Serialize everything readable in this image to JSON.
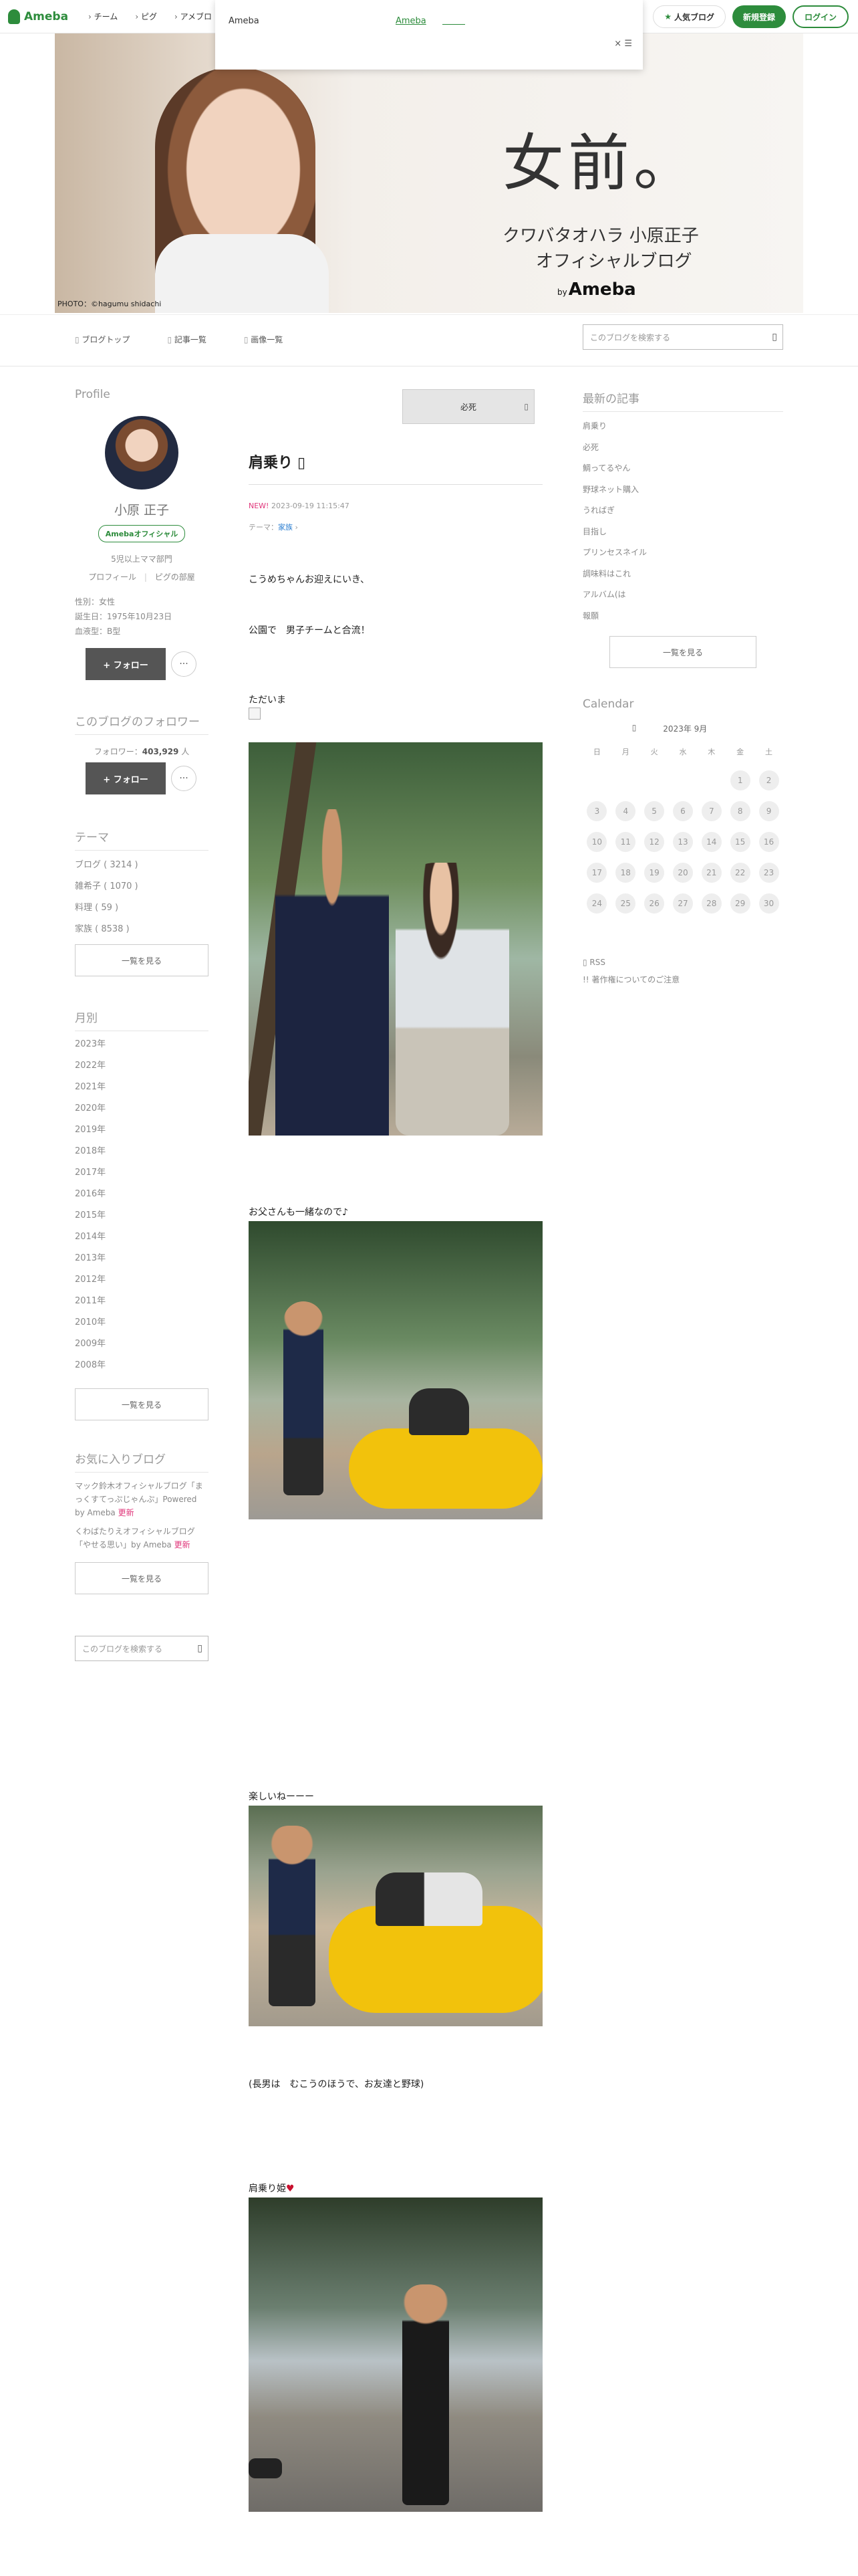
{
  "topbar": {
    "logo": "Ameba",
    "nav": [
      "チーム",
      "ピグ",
      "アメブロ"
    ],
    "popular": "人気ブログ",
    "register": "新規登録",
    "login": "ログイン"
  },
  "notice": {
    "left": "Ameba",
    "right": "Ameba",
    "close": "×"
  },
  "banner": {
    "title": "女前。",
    "sub1": "クワバタオハラ 小原正子",
    "sub2": "オフィシャルブログ",
    "by": "by",
    "brand": "Ameba",
    "credit": "PHOTO：©hagumu shidachi"
  },
  "subnav": {
    "links": [
      "ブログトップ",
      "記事一覧",
      "画像一覧"
    ],
    "search_placeholder": "このブログを検索する"
  },
  "profile": {
    "heading": "Profile",
    "name": "小原 正子",
    "badge": "Amebaオフィシャル",
    "category": "5児以上ママ部門",
    "links": [
      "プロフィール",
      "ピグの部屋"
    ],
    "gender": "性別：女性",
    "birthday": "誕生日：1975年10月23日",
    "blood": "血液型：B型",
    "follow": "+ フォロー",
    "more": "···"
  },
  "followers": {
    "heading": "このブログのフォロワー",
    "label": "フォロワー：",
    "count": "403,929",
    "unit": "人",
    "follow": "+ フォロー",
    "more": "···"
  },
  "themes": {
    "heading": "テーマ",
    "items": [
      "ブログ ( 3214 )",
      "雑希子 ( 1070 )",
      "料理 ( 59 )",
      "家族 ( 8538 )"
    ],
    "more": "一覧を見る"
  },
  "archive": {
    "heading": "月別",
    "items": [
      "2023年",
      "2022年",
      "2021年",
      "2020年",
      "2019年",
      "2018年",
      "2017年",
      "2016年",
      "2015年",
      "2014年",
      "2013年",
      "2012年",
      "2011年",
      "2010年",
      "2009年",
      "2008年"
    ],
    "more": "一覧を見る"
  },
  "favorites": {
    "heading": "お気に入りブログ",
    "item1": "マック鈴木オフィシャルブログ「まっくすてっぷじゃんぷ」Powered by Ameba",
    "item1_badge": "更新",
    "item2": "くわばたりえオフィシャルブログ「やせる思い」by Ameba",
    "item2_badge": "更新",
    "more": "一覧を見る",
    "search_placeholder": "このブログを検索する"
  },
  "article": {
    "tag_button": "必死",
    "title": "肩乗り",
    "new": "NEW!",
    "date": "2023-09-19 11:15:47",
    "theme_label": "テーマ：",
    "theme": "家族",
    "p1": "こうめちゃんお迎えにいき、",
    "p2": "公園で　男子チームと合流！",
    "p3": "ただいま",
    "p4": "お父さんも一緒なので♪",
    "p5": "楽しいねーーー",
    "p6": "(長男は　むこうのほうで、お友達と野球)",
    "p7": "肩乗り姫"
  },
  "recent": {
    "heading": "最新の記事",
    "items": [
      "肩乗り",
      "必死",
      "鯛ってるやん",
      "野球ネット購入",
      "うればぎ",
      "目指し",
      "プリンセスネイル",
      "調味料はこれ",
      "アルバム(は",
      "報願"
    ],
    "more": "一覧を見る"
  },
  "calendar": {
    "heading": "Calendar",
    "month": "2023年 9月",
    "weekdays": [
      "日",
      "月",
      "火",
      "水",
      "木",
      "金",
      "土"
    ],
    "rows": [
      [
        "",
        "",
        "",
        "",
        "",
        "1",
        "2"
      ],
      [
        "3",
        "4",
        "5",
        "6",
        "7",
        "8",
        "9"
      ],
      [
        "10",
        "11",
        "12",
        "13",
        "14",
        "15",
        "16"
      ],
      [
        "17",
        "18",
        "19",
        "20",
        "21",
        "22",
        "23"
      ],
      [
        "24",
        "25",
        "26",
        "27",
        "28",
        "29",
        "30"
      ]
    ],
    "rss": "RSS",
    "copyright": "著作権についてのご注意"
  },
  "colors": {
    "brand": "#2d8c3c",
    "follow_btn": "#555555",
    "new_badge": "#e0357a"
  }
}
